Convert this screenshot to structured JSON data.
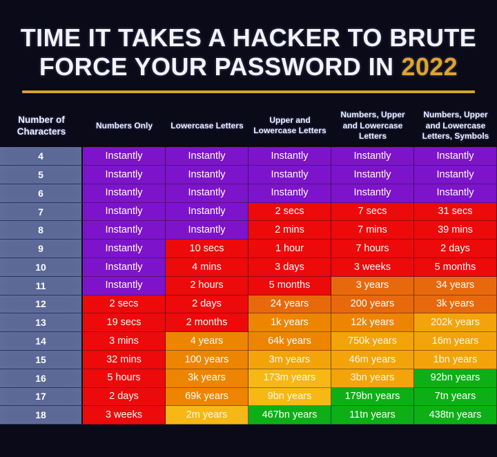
{
  "title": {
    "line1": "TIME IT TAKES A HACKER TO BRUTE",
    "line2": "FORCE YOUR PASSWORD IN",
    "year": "2022",
    "accent_color": "#e0a42a"
  },
  "chart_data": {
    "type": "heatmap",
    "title": "TIME IT TAKES A HACKER TO BRUTE FORCE YOUR PASSWORD IN 2022",
    "xlabel": "",
    "ylabel": "Number of Characters",
    "grid": true,
    "legend_position": "none",
    "row_header": "Number of Characters",
    "categories": [
      "Numbers Only",
      "Lowercase Letters",
      "Upper and Lowercase Letters",
      "Numbers, Upper and Lowercase Letters",
      "Numbers, Upper and Lowercase Letters, Symbols"
    ],
    "column_headers": [
      "Number of Characters",
      "Numbers Only",
      "Lowercase Letters",
      "Upper and Lowercase Letters",
      "Numbers, Upper and Lowercase Letters",
      "Numbers, Upper and Lowercase Letters, Symbols"
    ],
    "x": [
      4,
      5,
      6,
      7,
      8,
      9,
      10,
      11,
      12,
      13,
      14,
      15,
      16,
      17,
      18
    ],
    "colors": {
      "instant_purple": "#7d14cb",
      "red": "#ed0a0a",
      "orange_dark": "#e8690c",
      "orange": "#ee8500",
      "amber": "#f3a40b",
      "amber_light": "#f7b715",
      "green": "#0cb016",
      "index_blue": "#5b6796",
      "background": "#0a0a18"
    },
    "rows": [
      {
        "chars": "4",
        "values": [
          "Instantly",
          "Instantly",
          "Instantly",
          "Instantly",
          "Instantly"
        ],
        "heat": [
          "c-purple",
          "c-purple",
          "c-purple",
          "c-purple",
          "c-purple"
        ]
      },
      {
        "chars": "5",
        "values": [
          "Instantly",
          "Instantly",
          "Instantly",
          "Instantly",
          "Instantly"
        ],
        "heat": [
          "c-purple",
          "c-purple",
          "c-purple",
          "c-purple",
          "c-purple"
        ]
      },
      {
        "chars": "6",
        "values": [
          "Instantly",
          "Instantly",
          "Instantly",
          "Instantly",
          "Instantly"
        ],
        "heat": [
          "c-purple",
          "c-purple",
          "c-purple",
          "c-purple",
          "c-purple"
        ]
      },
      {
        "chars": "7",
        "values": [
          "Instantly",
          "Instantly",
          "2 secs",
          "7 secs",
          "31 secs"
        ],
        "heat": [
          "c-purple",
          "c-purple",
          "c-red",
          "c-red",
          "c-red"
        ]
      },
      {
        "chars": "8",
        "values": [
          "Instantly",
          "Instantly",
          "2 mins",
          "7 mins",
          "39 mins"
        ],
        "heat": [
          "c-purple",
          "c-purple",
          "c-red",
          "c-red",
          "c-red"
        ]
      },
      {
        "chars": "9",
        "values": [
          "Instantly",
          "10 secs",
          "1 hour",
          "7 hours",
          "2 days"
        ],
        "heat": [
          "c-purple",
          "c-red",
          "c-red",
          "c-red",
          "c-red"
        ]
      },
      {
        "chars": "10",
        "values": [
          "Instantly",
          "4 mins",
          "3 days",
          "3 weeks",
          "5 months"
        ],
        "heat": [
          "c-purple",
          "c-red",
          "c-red",
          "c-red",
          "c-red"
        ]
      },
      {
        "chars": "11",
        "values": [
          "Instantly",
          "2 hours",
          "5 months",
          "3 years",
          "34 years"
        ],
        "heat": [
          "c-purple",
          "c-red",
          "c-red",
          "c-orange1",
          "c-orange1"
        ]
      },
      {
        "chars": "12",
        "values": [
          "2 secs",
          "2 days",
          "24 years",
          "200 years",
          "3k years"
        ],
        "heat": [
          "c-red",
          "c-red",
          "c-orange1",
          "c-orange1",
          "c-orange1"
        ]
      },
      {
        "chars": "13",
        "values": [
          "19 secs",
          "2 months",
          "1k years",
          "12k years",
          "202k years"
        ],
        "heat": [
          "c-red",
          "c-red",
          "c-orange2",
          "c-orange2",
          "c-amber1"
        ]
      },
      {
        "chars": "14",
        "values": [
          "3 mins",
          "4 years",
          "64k years",
          "750k years",
          "16m years"
        ],
        "heat": [
          "c-red",
          "c-orange2",
          "c-orange2",
          "c-amber1",
          "c-amber1"
        ]
      },
      {
        "chars": "15",
        "values": [
          "32 mins",
          "100 years",
          "3m years",
          "46m years",
          "1bn years"
        ],
        "heat": [
          "c-red",
          "c-orange2",
          "c-amber1",
          "c-amber1",
          "c-amber1"
        ]
      },
      {
        "chars": "16",
        "values": [
          "5 hours",
          "3k years",
          "173m years",
          "3bn years",
          "92bn years"
        ],
        "heat": [
          "c-red",
          "c-orange2",
          "c-amber2",
          "c-amber1",
          "c-green"
        ]
      },
      {
        "chars": "17",
        "values": [
          "2 days",
          "69k years",
          "9bn years",
          "179bn years",
          "7tn years"
        ],
        "heat": [
          "c-red",
          "c-orange2",
          "c-amber2",
          "c-green",
          "c-green"
        ]
      },
      {
        "chars": "18",
        "values": [
          "3 weeks",
          "2m years",
          "467bn years",
          "11tn years",
          "438tn years"
        ],
        "heat": [
          "c-red",
          "c-amber2",
          "c-green",
          "c-green",
          "c-green"
        ]
      }
    ]
  }
}
